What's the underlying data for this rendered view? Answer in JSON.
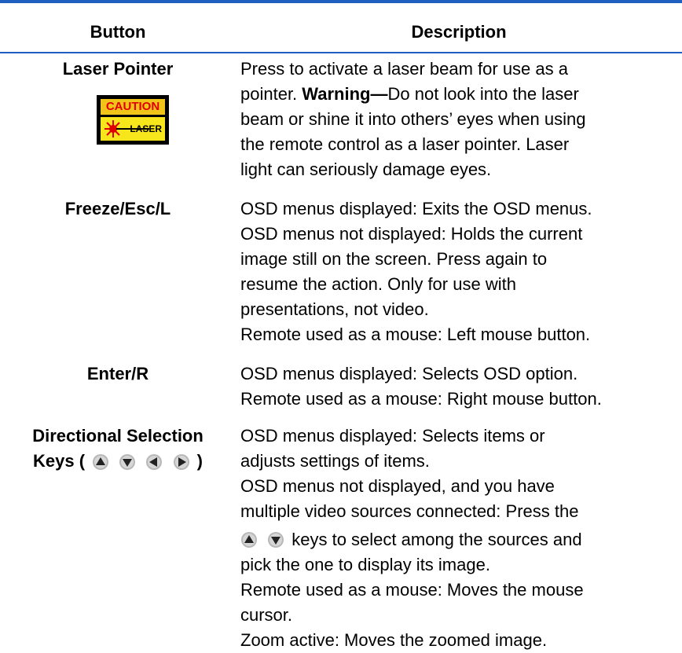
{
  "header": {
    "button": "Button",
    "description": "Description"
  },
  "rows": [
    {
      "button": "Laser Pointer",
      "caution_label": "CAUTION",
      "laser_label": "LASER",
      "desc": [
        "Press to activate a laser beam for use as a",
        "pointer.",
        "Warning—",
        "Do not look into the laser",
        "beam or shine it into others’ eyes when using",
        "the remote control as a laser pointer. Laser",
        "light can seriously damage eyes."
      ]
    },
    {
      "button": "Freeze/Esc/L",
      "desc": [
        "OSD menus displayed: Exits the OSD menus.",
        "OSD menus not displayed: Holds the current",
        "image still on the screen. Press again to",
        "resume the action. Only for use with",
        "presentations, not video.",
        "Remote used as a mouse: Left mouse button."
      ]
    },
    {
      "button": "Enter/R",
      "desc": [
        "OSD menus displayed: Selects OSD option.",
        "Remote used as a mouse: Right mouse button."
      ]
    },
    {
      "button_line1": "Directional Selection",
      "button_line2_prefix": "Keys (",
      "button_line2_suffix": ")",
      "desc": [
        "OSD menus displayed: Selects items or",
        "adjusts settings of items.",
        "OSD menus not displayed, and you have",
        "multiple video sources connected: Press the",
        "keys to select among the sources and",
        "pick the one to display its image.",
        "Remote used as a mouse: Moves the mouse",
        "cursor.",
        "Zoom active: Moves the zoomed image."
      ]
    }
  ],
  "icons": [
    "up-arrow-icon",
    "down-arrow-icon",
    "left-arrow-icon",
    "right-arrow-icon"
  ]
}
